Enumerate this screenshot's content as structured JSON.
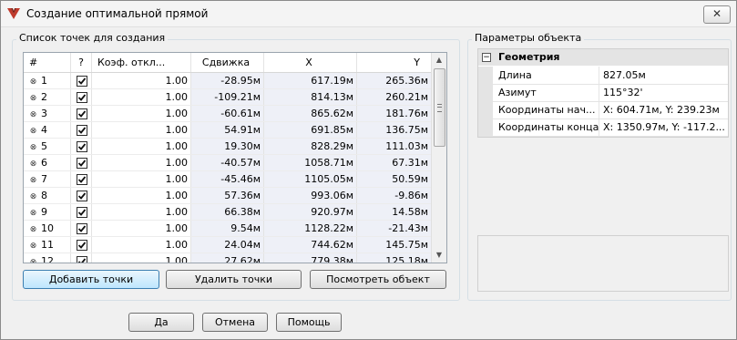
{
  "window": {
    "title": "Создание оптимальной прямой",
    "close_label": "✕"
  },
  "points_group": {
    "label": "Список точек для создания"
  },
  "params_group": {
    "label": "Параметры объекта"
  },
  "table": {
    "columns": [
      "#",
      "?",
      "Коэф. откл...",
      "Сдвижка",
      "X",
      "Y"
    ],
    "rows": [
      {
        "num": "1",
        "checked": true,
        "coef": "1.00",
        "shift": "-28.95м",
        "x": "617.19м",
        "y": "265.36м"
      },
      {
        "num": "2",
        "checked": true,
        "coef": "1.00",
        "shift": "-109.21м",
        "x": "814.13м",
        "y": "260.21м"
      },
      {
        "num": "3",
        "checked": true,
        "coef": "1.00",
        "shift": "-60.61м",
        "x": "865.62м",
        "y": "181.76м"
      },
      {
        "num": "4",
        "checked": true,
        "coef": "1.00",
        "shift": "54.91м",
        "x": "691.85м",
        "y": "136.75м"
      },
      {
        "num": "5",
        "checked": true,
        "coef": "1.00",
        "shift": "19.30м",
        "x": "828.29м",
        "y": "111.03м"
      },
      {
        "num": "6",
        "checked": true,
        "coef": "1.00",
        "shift": "-40.57м",
        "x": "1058.71м",
        "y": "67.31м"
      },
      {
        "num": "7",
        "checked": true,
        "coef": "1.00",
        "shift": "-45.46м",
        "x": "1105.05м",
        "y": "50.59м"
      },
      {
        "num": "8",
        "checked": true,
        "coef": "1.00",
        "shift": "57.36м",
        "x": "993.06м",
        "y": "-9.86м"
      },
      {
        "num": "9",
        "checked": true,
        "coef": "1.00",
        "shift": "66.38м",
        "x": "920.97м",
        "y": "14.58м"
      },
      {
        "num": "10",
        "checked": true,
        "coef": "1.00",
        "shift": "9.54м",
        "x": "1128.22м",
        "y": "-21.43м"
      },
      {
        "num": "11",
        "checked": true,
        "coef": "1.00",
        "shift": "24.04м",
        "x": "744.62м",
        "y": "145.75м"
      },
      {
        "num": "12",
        "checked": true,
        "coef": "1.00",
        "shift": "27.62м",
        "x": "779.38м",
        "y": "125.18м"
      }
    ]
  },
  "buttons": {
    "add_points": "Добавить точки",
    "delete_points": "Удалить точки",
    "view_object": "Посмотреть объект",
    "ok": "Да",
    "cancel": "Отмена",
    "help": "Помощь"
  },
  "properties": {
    "category": "Геометрия",
    "category_toggle": "−",
    "rows": [
      {
        "name": "Длина",
        "value": "827.05м"
      },
      {
        "name": "Азимут",
        "value": "115°32'"
      },
      {
        "name": "Координаты нач...",
        "value": "X: 604.71м, Y: 239.23м"
      },
      {
        "name": "Координаты конца",
        "value": "X: 1350.97м, Y: -117.2..."
      }
    ]
  },
  "icons": {
    "app": "app-logo-icon",
    "row": "node-icon",
    "check": "checkmark-icon",
    "scroll_up": "scroll-up-icon",
    "scroll_down": "scroll-down-icon"
  },
  "colors": {
    "accent_logo": "#c0392b",
    "focus_border": "#3c7fb1",
    "numeric_cell_bg": "#eef0f7"
  }
}
